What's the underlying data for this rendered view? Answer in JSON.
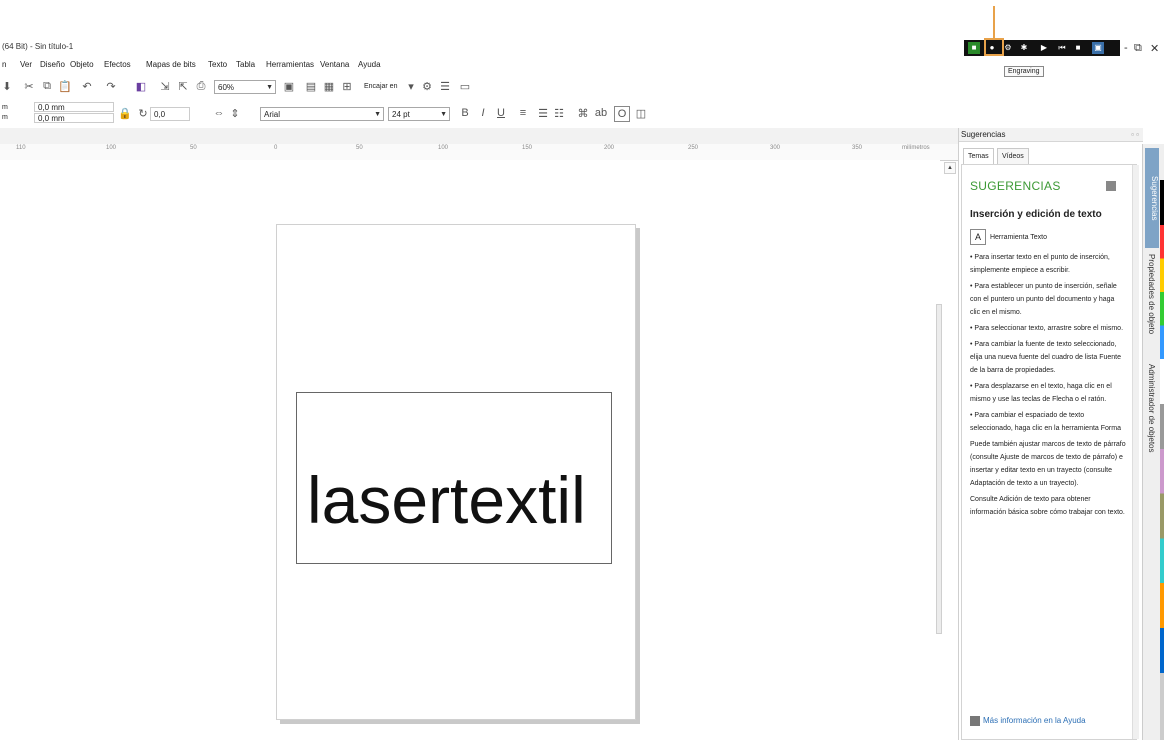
{
  "window": {
    "title": "(64 Bit) - Sin título-1",
    "tooltip": "Engraving",
    "controls": {
      "minimize": "-",
      "restore": "⧉",
      "close": "✕"
    }
  },
  "menu": [
    "n",
    "Ver",
    "Diseño",
    "Objeto",
    "Efectos",
    "Mapas de bits",
    "Texto",
    "Tabla",
    "Herramientas",
    "Ventana",
    "Ayuda"
  ],
  "toolbar": {
    "zoom": "60%",
    "snap_label": "Encajar en"
  },
  "propbar": {
    "left1": "m",
    "left2": "m",
    "width_value": "0,0 mm",
    "height_value": "0,0 mm",
    "rotation": "0,0",
    "font": "Arial",
    "font_size": "24 pt"
  },
  "ruler": {
    "ticks": [
      "110",
      "100",
      "50",
      "0",
      "50",
      "100",
      "150",
      "200",
      "250",
      "300",
      "350"
    ],
    "unit": "milímetros"
  },
  "document": {
    "text": "lasertextil"
  },
  "panel": {
    "header": "Sugerencias",
    "tabs": [
      "Temas",
      "Vídeos"
    ],
    "heading": "SUGERENCIAS",
    "section_title": "Inserción y edición de texto",
    "tool_name": "Herramienta Texto",
    "bullets": [
      "• Para insertar texto en el punto de inserción, simplemente empiece a escribir.",
      "• Para establecer un punto de inserción, señale con el puntero un punto del documento y haga clic en el mismo.",
      "• Para seleccionar texto, arrastre sobre el mismo.",
      "• Para cambiar la fuente de texto seleccionado, elija una nueva fuente del cuadro de lista Fuente de la barra de propiedades.",
      "• Para desplazarse en el texto, haga clic en el mismo y use las teclas de Flecha o el ratón.",
      "• Para cambiar el espaciado de texto seleccionado, haga clic en la herramienta Forma"
    ],
    "para1": "Puede también ajustar marcos de texto de párrafo (consulte Ajuste de marcos de texto de párrafo) e insertar y editar texto en un trayecto (consulte Adaptación de texto a un trayecto).",
    "para2": "Consulte Adición de texto para obtener información básica sobre cómo trabajar con texto.",
    "help_link": "Más información en la Ayuda"
  },
  "side_tabs": [
    "Sugerencias",
    "Propiedades de objeto",
    "Administrador de objetos"
  ]
}
